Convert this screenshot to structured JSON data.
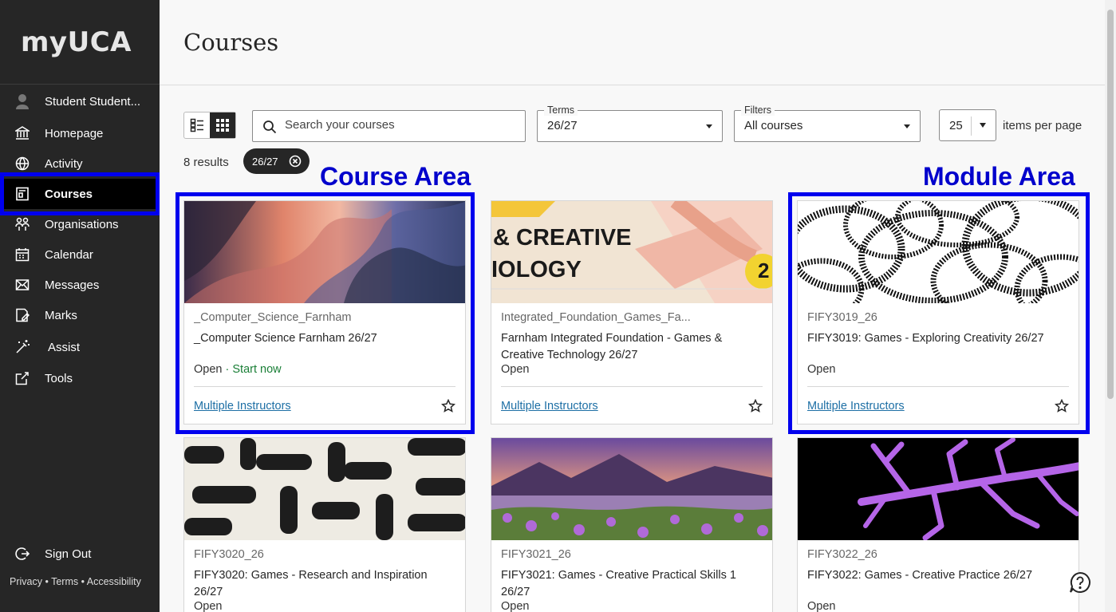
{
  "sidebar": {
    "logo": "myUCA",
    "user": "Student Student...",
    "items": [
      {
        "label": "Homepage"
      },
      {
        "label": "Activity"
      },
      {
        "label": "Courses"
      },
      {
        "label": "Organisations"
      },
      {
        "label": "Calendar"
      },
      {
        "label": "Messages"
      },
      {
        "label": "Marks"
      },
      {
        "label": "Assist"
      },
      {
        "label": "Tools"
      }
    ],
    "sign_out": "Sign Out",
    "footer": {
      "privacy": "Privacy",
      "terms": "Terms",
      "accessibility": "Accessibility",
      "sep": " • "
    }
  },
  "header": {
    "title": "Courses"
  },
  "toolbar": {
    "search_placeholder": "Search your courses",
    "terms_label": "Terms",
    "terms_value": "26/27",
    "filters_label": "Filters",
    "filters_value": "All courses",
    "per_page_value": "25",
    "per_page_label": "items per page"
  },
  "results": {
    "count_text": "8 results",
    "chip": "26/27"
  },
  "annotations": {
    "course_area": "Course Area",
    "module_area": "Module Area"
  },
  "cards": [
    {
      "code": "_Computer_Science_Farnham",
      "title": "_Computer Science Farnham 26/27",
      "status": "Open",
      "start": " · Start now",
      "instructors": "Multiple Instructors"
    },
    {
      "code": "Integrated_Foundation_Games_Fa...",
      "title": "Farnham Integrated Foundation - Games & Creative Technology 26/27",
      "status": "Open",
      "instructors": "Multiple Instructors",
      "img_text_1": "& CREATIVE",
      "img_text_2": "IOLOGY",
      "img_text_3": "2"
    },
    {
      "code": "FIFY3019_26",
      "title": "FIFY3019: Games - Exploring Creativity 26/27",
      "status": "Open",
      "instructors": "Multiple Instructors"
    },
    {
      "code": "FIFY3020_26",
      "title": "FIFY3020: Games - Research and Inspiration 26/27",
      "status": "Open"
    },
    {
      "code": "FIFY3021_26",
      "title": "FIFY3021: Games - Creative Practical Skills 1 26/27",
      "status": "Open"
    },
    {
      "code": "FIFY3022_26",
      "title": "FIFY3022: Games - Creative Practice 26/27",
      "status": "Open"
    }
  ],
  "colors": {
    "accent_annotation": "#0000ee",
    "sidebar_bg": "#262626",
    "link": "#1d6fa5",
    "start_now": "#1a7f37"
  }
}
